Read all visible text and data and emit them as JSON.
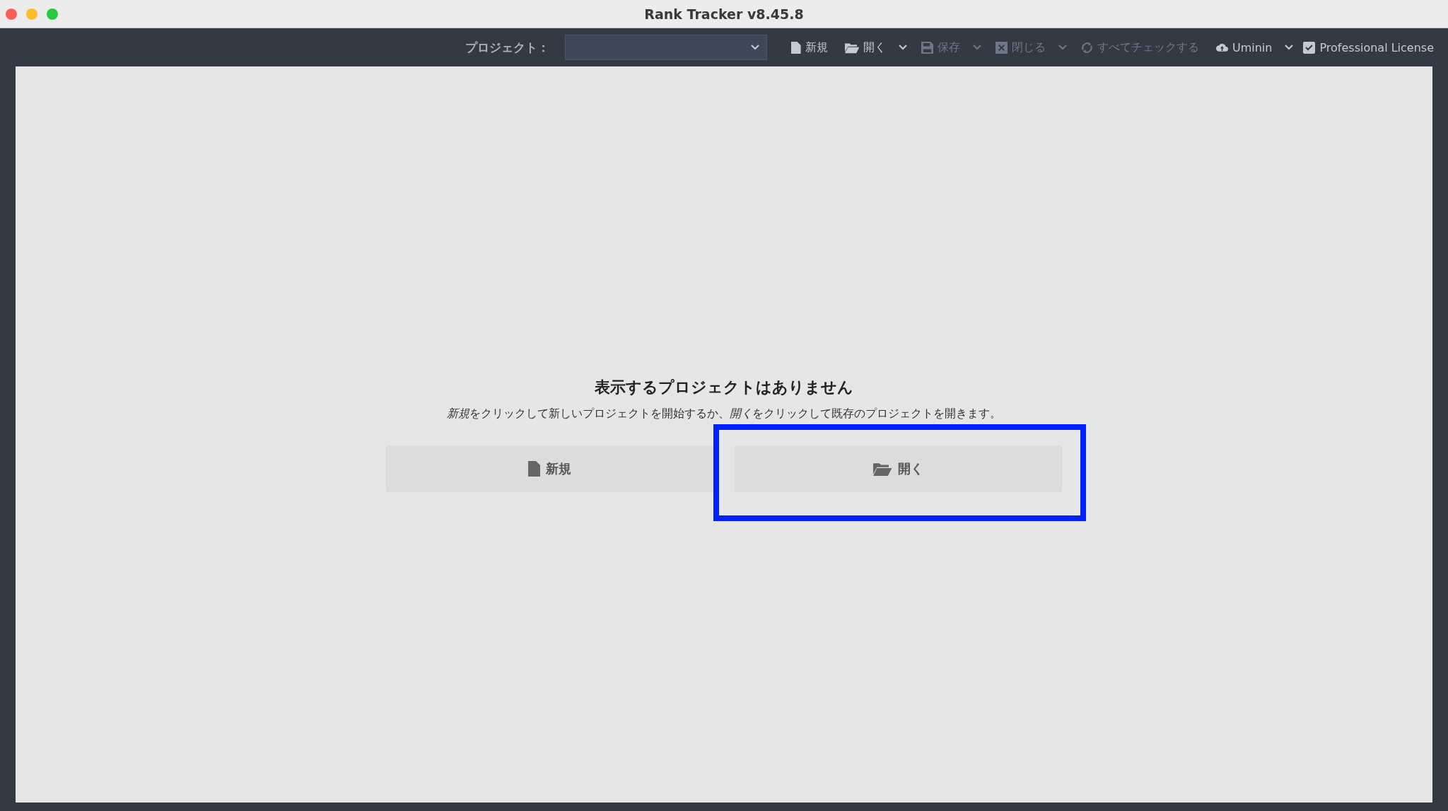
{
  "window": {
    "title": "Rank Tracker v8.45.8"
  },
  "toolbar": {
    "project_label": "プロジェクト：",
    "items": [
      {
        "kind": "button",
        "label": "新規",
        "disabled": false,
        "menu": false
      },
      {
        "kind": "button",
        "label": "開く",
        "disabled": false,
        "menu": true
      },
      {
        "kind": "button",
        "label": "保存",
        "disabled": true,
        "menu": true
      },
      {
        "kind": "button",
        "label": "閉じる",
        "disabled": true,
        "menu": true
      },
      {
        "kind": "button",
        "label": "すべてチェックする",
        "disabled": true,
        "menu": false
      },
      {
        "kind": "button",
        "label": "Uminin",
        "disabled": false,
        "menu": true
      },
      {
        "kind": "checkbox",
        "label": "Professional License",
        "checked": true
      }
    ]
  },
  "empty_state": {
    "title": "表示するプロジェクトはありません",
    "message": [
      {
        "text": "新規",
        "italic": true
      },
      {
        "text": "をクリックして新しいプロジェクトを開始するか、",
        "italic": false
      },
      {
        "text": "開く",
        "italic": true
      },
      {
        "text": "をクリックして既存のプロジェクトを開きます。",
        "italic": false
      }
    ],
    "buttons": [
      {
        "label": "新規",
        "highlighted": false
      },
      {
        "label": "開く",
        "highlighted": true
      }
    ]
  }
}
